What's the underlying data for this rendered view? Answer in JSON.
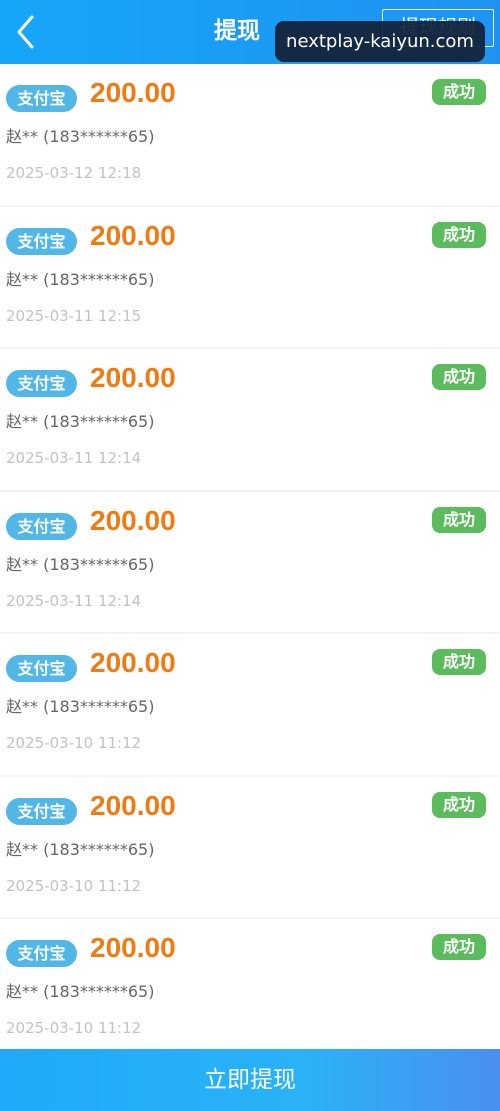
{
  "header": {
    "title": "提现",
    "rules_label": "提现规则",
    "watermark": "nextplay-kaiyun.com"
  },
  "records": [
    {
      "method": "支付宝",
      "amount": "200.00",
      "status": "成功",
      "account": "赵** (183******65)",
      "time": "2025-03-12 12:18"
    },
    {
      "method": "支付宝",
      "amount": "200.00",
      "status": "成功",
      "account": "赵** (183******65)",
      "time": "2025-03-11 12:15"
    },
    {
      "method": "支付宝",
      "amount": "200.00",
      "status": "成功",
      "account": "赵** (183******65)",
      "time": "2025-03-11 12:14"
    },
    {
      "method": "支付宝",
      "amount": "200.00",
      "status": "成功",
      "account": "赵** (183******65)",
      "time": "2025-03-11 12:14"
    },
    {
      "method": "支付宝",
      "amount": "200.00",
      "status": "成功",
      "account": "赵** (183******65)",
      "time": "2025-03-10 11:12"
    },
    {
      "method": "支付宝",
      "amount": "200.00",
      "status": "成功",
      "account": "赵** (183******65)",
      "time": "2025-03-10 11:12"
    },
    {
      "method": "支付宝",
      "amount": "200.00",
      "status": "成功",
      "account": "赵** (183******65)",
      "time": "2025-03-10 11:12"
    }
  ],
  "footer": {
    "submit_label": "立即提现"
  },
  "colors": {
    "header_blue": "#1e93f3",
    "amount_orange": "#ef7b12",
    "alipay_badge": "#52b6e6",
    "success_green": "#5cbb5c"
  },
  "icons": {
    "back": "chevron-left-icon"
  }
}
